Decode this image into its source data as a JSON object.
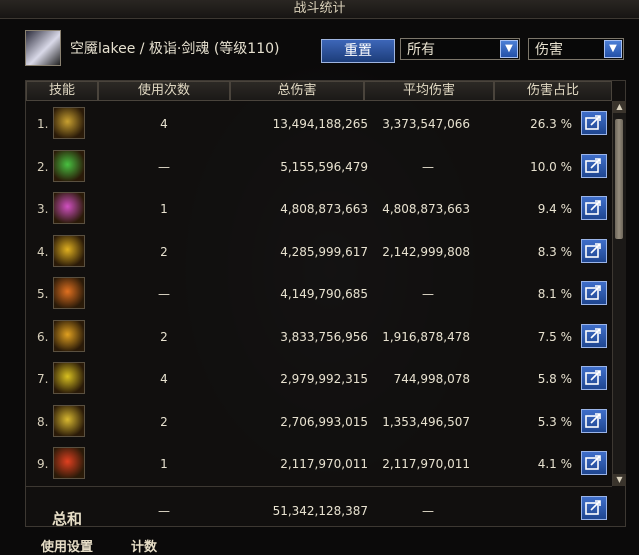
{
  "window": {
    "title": "战斗统计"
  },
  "header": {
    "character": "空魇lakee / 极诣·剑魂 (等级110)",
    "reset_label": "重置",
    "filter1": "所有",
    "filter2": "伤害"
  },
  "columns": [
    "技能",
    "使用次数",
    "总伤害",
    "平均伤害",
    "伤害占比"
  ],
  "rows": [
    {
      "rank": "1.",
      "count": "4",
      "total": "13,494,188,265",
      "avg": "3,373,547,066",
      "pct": "26.3 %",
      "icon_color": "#c8a030"
    },
    {
      "rank": "2.",
      "count": "—",
      "total": "5,155,596,479",
      "avg": "—",
      "pct": "10.0 %",
      "icon_color": "#48c040"
    },
    {
      "rank": "3.",
      "count": "1",
      "total": "4,808,873,663",
      "avg": "4,808,873,663",
      "pct": "9.4 %",
      "icon_color": "#d050c0"
    },
    {
      "rank": "4.",
      "count": "2",
      "total": "4,285,999,617",
      "avg": "2,142,999,808",
      "pct": "8.3 %",
      "icon_color": "#e0b020"
    },
    {
      "rank": "5.",
      "count": "—",
      "total": "4,149,790,685",
      "avg": "—",
      "pct": "8.1 %",
      "icon_color": "#e07020"
    },
    {
      "rank": "6.",
      "count": "2",
      "total": "3,833,756,956",
      "avg": "1,916,878,478",
      "pct": "7.5 %",
      "icon_color": "#e0a020"
    },
    {
      "rank": "7.",
      "count": "4",
      "total": "2,979,992,315",
      "avg": "744,998,078",
      "pct": "5.8 %",
      "icon_color": "#d8c020"
    },
    {
      "rank": "8.",
      "count": "2",
      "total": "2,706,993,015",
      "avg": "1,353,496,507",
      "pct": "5.3 %",
      "icon_color": "#d8b830"
    },
    {
      "rank": "9.",
      "count": "1",
      "total": "2,117,970,011",
      "avg": "2,117,970,011",
      "pct": "4.1 %",
      "icon_color": "#e04020"
    }
  ],
  "summary": {
    "label": "总和",
    "count": "—",
    "total": "51,342,128,387",
    "avg": "—"
  },
  "footer_tabs": [
    "使用设置",
    "计数"
  ]
}
